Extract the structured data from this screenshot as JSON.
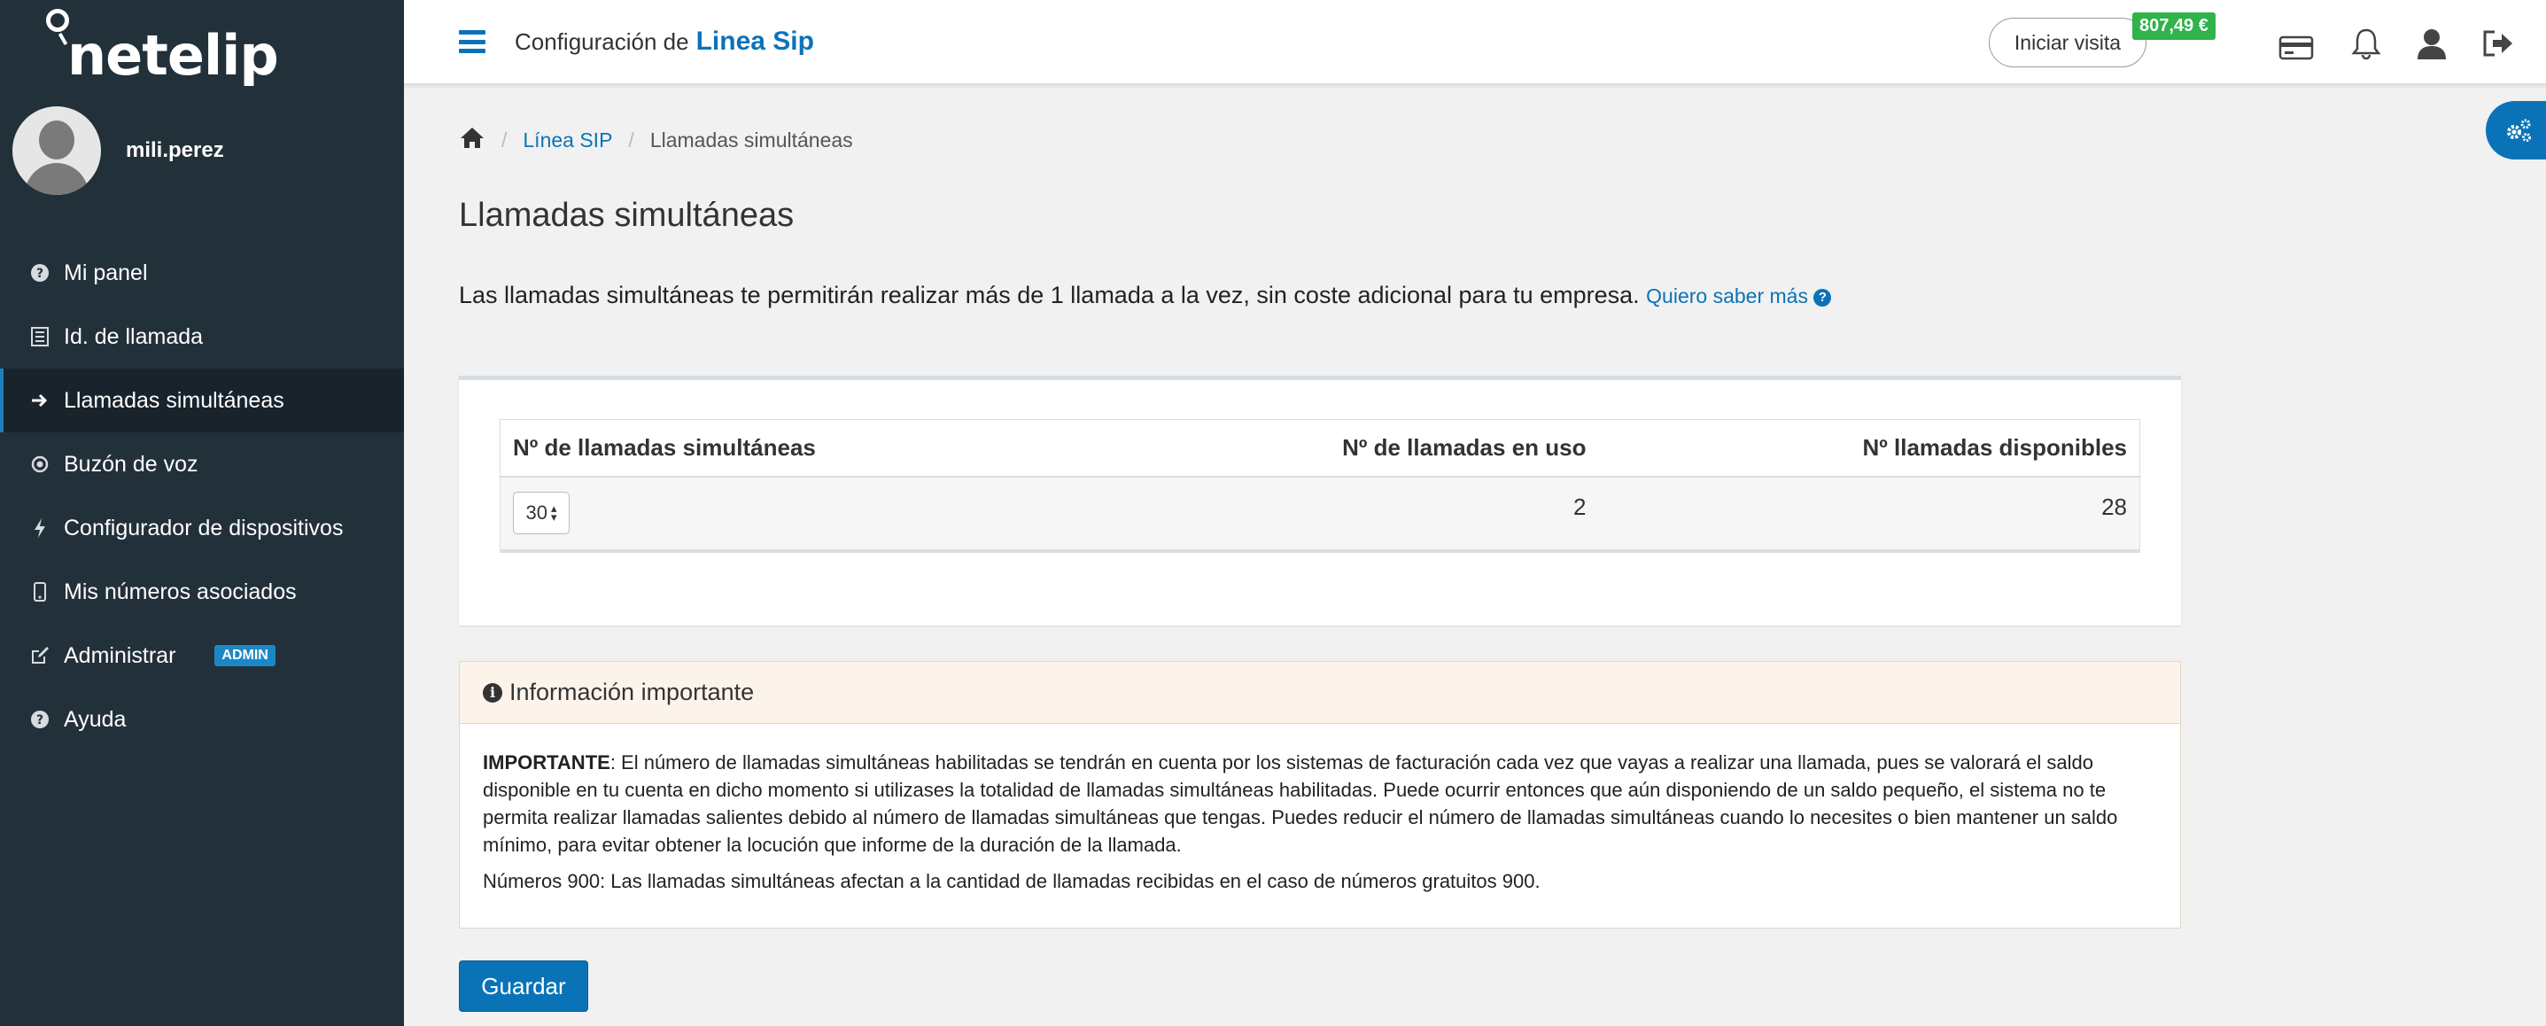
{
  "brand": {
    "logo_text": "netelip"
  },
  "user": {
    "name": "mili.perez"
  },
  "nav": {
    "items": [
      {
        "label": "Mi panel",
        "icon": "question-circle-icon"
      },
      {
        "label": "Id. de llamada",
        "icon": "list-icon"
      },
      {
        "label": "Llamadas simultáneas",
        "icon": "arrow-right-icon",
        "active": true
      },
      {
        "label": "Buzón de voz",
        "icon": "voicemail-icon"
      },
      {
        "label": "Configurador de dispositivos",
        "icon": "bolt-icon"
      },
      {
        "label": "Mis números asociados",
        "icon": "mobile-icon"
      },
      {
        "label": "Administrar",
        "icon": "edit-icon",
        "badge": "ADMIN"
      },
      {
        "label": "Ayuda",
        "icon": "question-circle-icon"
      }
    ]
  },
  "header": {
    "title_prefix": "Configuración de",
    "title_highlight": "Linea Sip",
    "visit_button": "Iniciar visita",
    "balance": "807,49 €"
  },
  "breadcrumb": {
    "level1": "Línea SIP",
    "current": "Llamadas simultáneas"
  },
  "page": {
    "title": "Llamadas simultáneas",
    "intro": "Las llamadas simultáneas te permitirán realizar más de 1 llamada a la vez, sin coste adicional para tu empresa.",
    "learn_more": "Quiero saber más"
  },
  "table": {
    "headers": [
      "Nº de llamadas simultáneas",
      "Nº de llamadas en uso",
      "Nº llamadas disponibles"
    ],
    "row": {
      "simultaneous": "30",
      "in_use": "2",
      "available": "28"
    }
  },
  "info": {
    "title": "Información importante",
    "important_label": "IMPORTANTE",
    "important_text": ": El número de llamadas simultáneas habilitadas se tendrán en cuenta por los sistemas de facturación cada vez que vayas a realizar una llamada, pues se valorará el saldo disponible en tu cuenta en dicho momento si utilizases la totalidad de llamadas simultáneas habilitadas. Puede ocurrir entonces que aún disponiendo de un saldo pequeño, el sistema no te permita realizar llamadas salientes debido al número de llamadas simultáneas que tengas. Puedes reducir el número de llamadas simultáneas cuando lo necesites o bien mantener un saldo mínimo, para evitar obtener la locución que informe de la duración de la llamada.",
    "note": "Números 900: Las llamadas simultáneas afectan a la cantidad de llamadas recibidas en el caso de números gratuitos 900."
  },
  "actions": {
    "save": "Guardar"
  }
}
